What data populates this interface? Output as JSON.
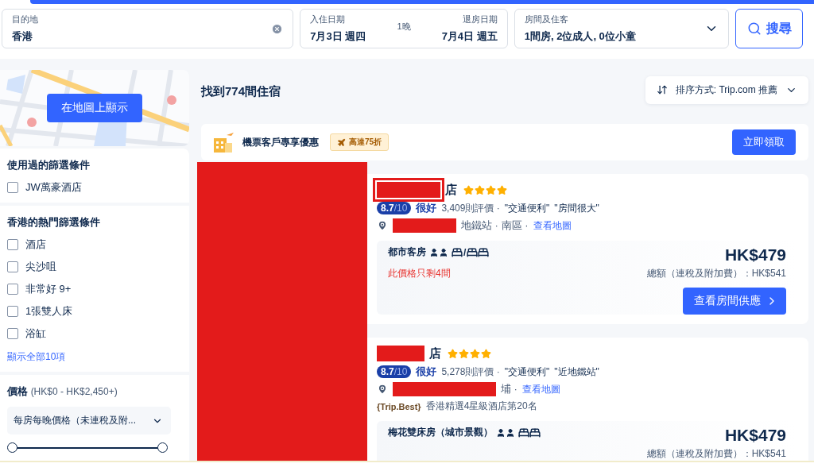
{
  "search": {
    "destination": {
      "label": "目的地",
      "value": "香港"
    },
    "checkin": {
      "label": "入住日期",
      "value": "7月3日 週四"
    },
    "nights": "1晚",
    "checkout": {
      "label": "退房日期",
      "value": "7月4日 週五"
    },
    "guests": {
      "label": "房間及住客",
      "value": "1間房, 2位成人, 0位小童"
    },
    "button": "搜尋"
  },
  "sidebar": {
    "map_button": "在地圖上顯示",
    "filter_groups": [
      {
        "title": "使用過的篩選條件",
        "items": [
          {
            "label": "JW萬豪酒店",
            "checked": false
          }
        ]
      },
      {
        "title": "香港的熱門篩選條件",
        "items": [
          {
            "label": "酒店",
            "checked": false
          },
          {
            "label": "尖沙咀",
            "checked": false
          },
          {
            "label": "非常好 9+",
            "checked": false
          },
          {
            "label": "1張雙人床",
            "checked": false
          },
          {
            "label": "浴缸",
            "checked": false
          }
        ],
        "show_all": "顯示全部10項"
      }
    ],
    "price": {
      "title": "價格",
      "range": "(HK$0 - HK$2,450+)",
      "dropdown": "每房每晚價格（未連稅及附...",
      "slider": {
        "level": 1
      }
    }
  },
  "results": {
    "title": "找到774間住宿",
    "sort": "排序方式: Trip.com 推薦",
    "promo": {
      "text": "機票客戶專享優惠",
      "badge": "高達75折",
      "button": "立即領取"
    },
    "images_redacted": true,
    "hotels": [
      {
        "name": "店",
        "redacted": true,
        "stars": 4,
        "score": "8.7",
        "score_max": "/10",
        "rating": "很好",
        "reviews": "3,409則評價 ·",
        "tags": [
          "\"交通便利\"",
          "\"房間很大\""
        ],
        "location": "地鐵站 · 南區 ·",
        "map_link": "查看地圖",
        "room": {
          "name": "都市客房",
          "bed_separator": "/",
          "scarcity": "此價格只剩4間"
        },
        "price": "HK$479",
        "total": "總額（連稅及附加費）：HK$541",
        "button": "查看房間供應"
      },
      {
        "name": "店",
        "redacted": true,
        "stars": 4,
        "score": "8.7",
        "score_max": "/10",
        "rating": "很好",
        "reviews": "5,278則評價 ·",
        "tags": [
          "\"交通便利\"",
          "\"近地鐵站\""
        ],
        "location": "埔 ·",
        "map_link": "查看地圖",
        "ranking": {
          "badge": "{Trip.Best}",
          "text": "香港精選4星級酒店第20名"
        },
        "room": {
          "name": "梅花雙床房（城市景觀）"
        },
        "price": "HK$479",
        "total": "總額（連稅及附加費）：HK$541"
      }
    ]
  }
}
